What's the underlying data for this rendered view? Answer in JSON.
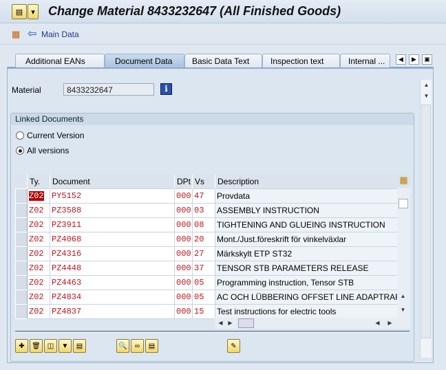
{
  "window": {
    "title": "Change Material 8433232647 (All Finished Goods)"
  },
  "toolbar": {
    "main_data": "Main Data"
  },
  "tabs": [
    {
      "label": "Additional EANs"
    },
    {
      "label": "Document Data",
      "selected": true
    },
    {
      "label": "Basic Data Text"
    },
    {
      "label": "Inspection text"
    },
    {
      "label": "Internal ..."
    }
  ],
  "material": {
    "label": "Material",
    "value": "8433232647"
  },
  "linked": {
    "title": "Linked Documents",
    "radio_current": "Current Version",
    "radio_all": "All versions",
    "selected": "All versions"
  },
  "table": {
    "headers": {
      "ty": "Ty.",
      "document": "Document",
      "dpt": "DPt",
      "vs": "Vs",
      "description": "Description"
    },
    "rows": [
      {
        "ty": "Z02",
        "document": "PY5152",
        "dpt": "000",
        "vs": "47",
        "description": "Provdata"
      },
      {
        "ty": "Z02",
        "document": "PZ3588",
        "dpt": "000",
        "vs": "03",
        "description": "ASSEMBLY INSTRUCTION"
      },
      {
        "ty": "Z02",
        "document": "PZ3911",
        "dpt": "000",
        "vs": "08",
        "description": "TIGHTENING AND GLUEING INSTRUCTION"
      },
      {
        "ty": "Z02",
        "document": "PZ4068",
        "dpt": "000",
        "vs": "20",
        "description": "Mont./Just.föreskrift för vinkelväxlar"
      },
      {
        "ty": "Z02",
        "document": "PZ4316",
        "dpt": "000",
        "vs": "27",
        "description": "Märkskylt ETP ST32"
      },
      {
        "ty": "Z02",
        "document": "PZ4448",
        "dpt": "000",
        "vs": "37",
        "description": "TENSOR STB PARAMETERS RELEASE"
      },
      {
        "ty": "Z02",
        "document": "PZ4463",
        "dpt": "000",
        "vs": "05",
        "description": "Programming instruction, Tensor STB"
      },
      {
        "ty": "Z02",
        "document": "PZ4834",
        "dpt": "000",
        "vs": "05",
        "description": "AC OCH LÜBBERING OFFSET LINE ADAPTRAR"
      },
      {
        "ty": "Z02",
        "document": "PZ4837",
        "dpt": "000",
        "vs": "15",
        "description": "Test instructions for electric tools"
      }
    ]
  },
  "colors": {
    "doc_text": "#c0141c",
    "highlight": "#b00000"
  }
}
